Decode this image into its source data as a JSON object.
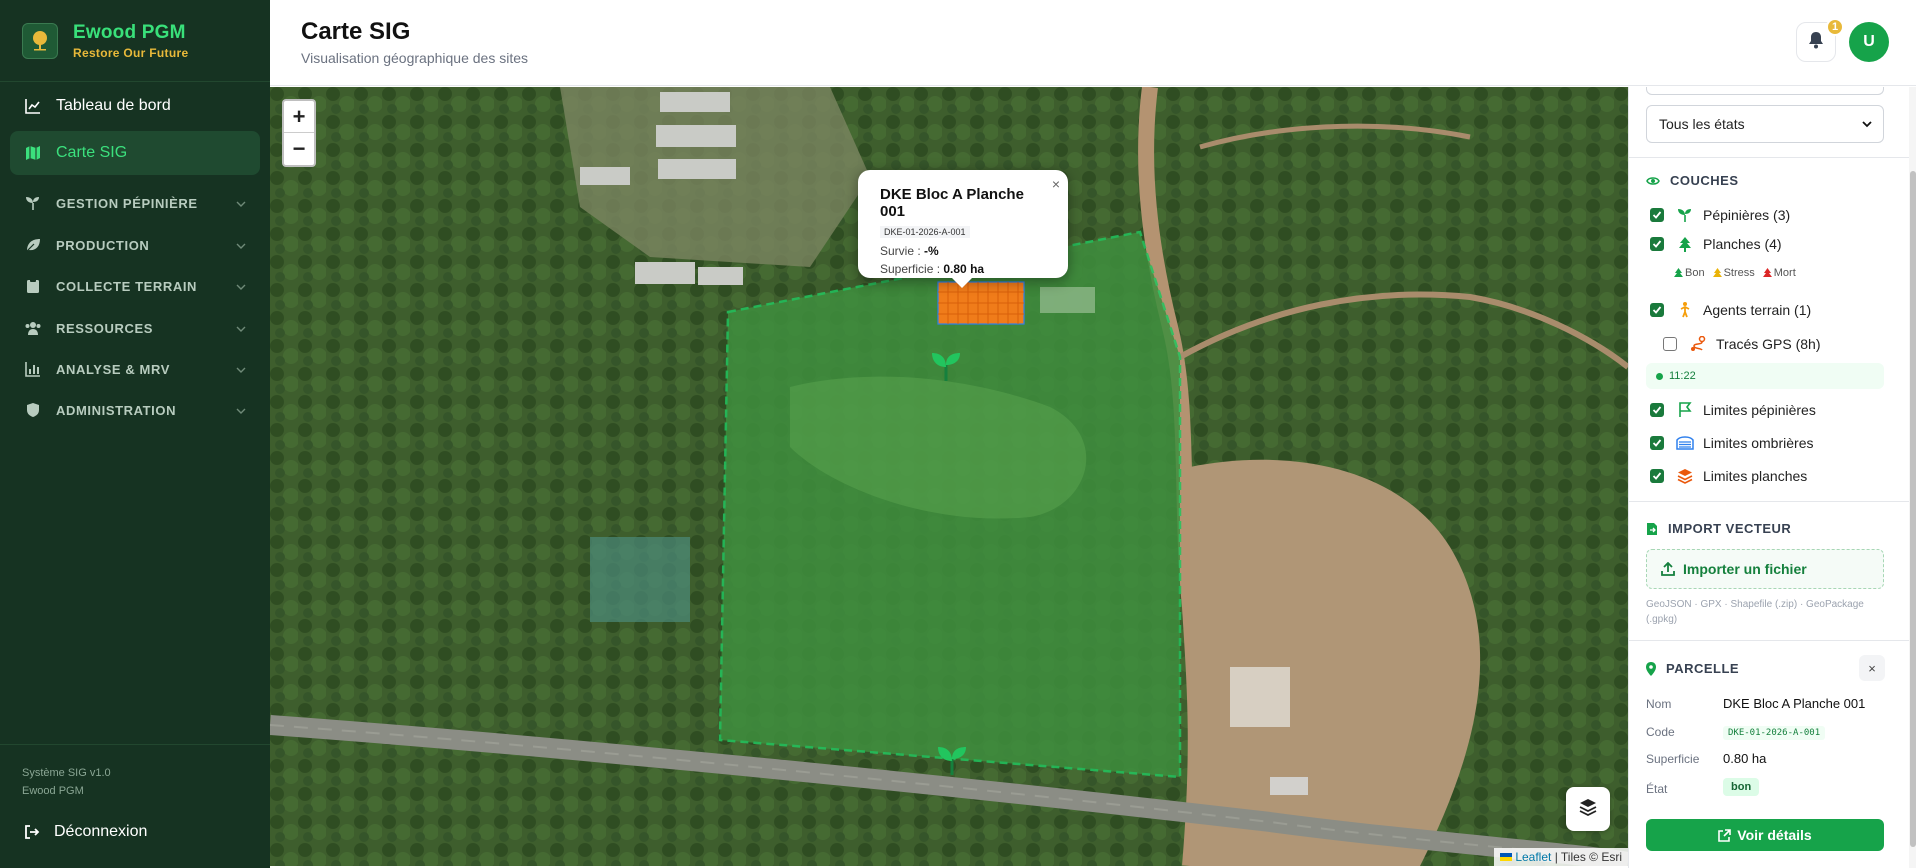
{
  "app": {
    "name": "Ewood PGM",
    "tagline": "Restore Our Future"
  },
  "sidebar": {
    "items": [
      {
        "label": "Tableau de bord"
      },
      {
        "label": "Carte SIG"
      },
      {
        "label": "GESTION PÉPINIÈRE"
      },
      {
        "label": "PRODUCTION"
      },
      {
        "label": "COLLECTE TERRAIN"
      },
      {
        "label": "RESSOURCES"
      },
      {
        "label": "ANALYSE & MRV"
      },
      {
        "label": "ADMINISTRATION"
      }
    ],
    "footer_version": "Système SIG v1.0",
    "footer_app": "Ewood PGM",
    "logout_label": "Déconnexion"
  },
  "header": {
    "title": "Carte SIG",
    "subtitle": "Visualisation géographique des sites",
    "notification_count": "1",
    "avatar_initial": "U"
  },
  "map": {
    "zoom_in": "+",
    "zoom_out": "−",
    "attribution_leaflet": "Leaflet",
    "attribution_tiles": "| Tiles © Esri",
    "popup": {
      "title": "DKE Bloc A Planche 001",
      "code": "DKE-01-2026-A-001",
      "survie_label": "Survie :",
      "survie_value": "-%",
      "superficie_label": "Superficie :",
      "superficie_value": "0.80 ha",
      "close": "×"
    }
  },
  "panel": {
    "state_filter": "Tous les états",
    "layers_title": "COUCHES",
    "layers": [
      {
        "label": "Pépinières (3)",
        "checked": true
      },
      {
        "label": "Planches (4)",
        "checked": true
      },
      {
        "label": "Agents terrain (1)",
        "checked": true
      },
      {
        "label": "Tracés GPS (8h)",
        "checked": false
      },
      {
        "label": "Limites pépinières",
        "checked": true
      },
      {
        "label": "Limites ombrières",
        "checked": true
      },
      {
        "label": "Limites planches",
        "checked": true
      }
    ],
    "legend": {
      "bon": "Bon",
      "stress": "Stress",
      "mort": "Mort"
    },
    "gps_time": "11:22",
    "import_title": "IMPORT VECTEUR",
    "import_button": "Importer un fichier",
    "import_formats": "GeoJSON · GPX · Shapefile (.zip) · GeoPackage (.gpkg)",
    "parcelle_title": "PARCELLE",
    "parcelle_close": "×",
    "parcelle": {
      "nom_label": "Nom",
      "nom": "DKE Bloc A Planche 001",
      "code_label": "Code",
      "code": "DKE-01-2026-A-001",
      "superficie_label": "Superficie",
      "superficie": "0.80 ha",
      "etat_label": "État",
      "etat": "bon"
    },
    "details_button": "Voir détails"
  },
  "colors": {
    "sidebar_bg": "#163322",
    "accent": "#16a34a",
    "brand_gold": "#e8b93a",
    "planche_orange": "#f07c1a",
    "boundary_green": "#22c55e"
  }
}
